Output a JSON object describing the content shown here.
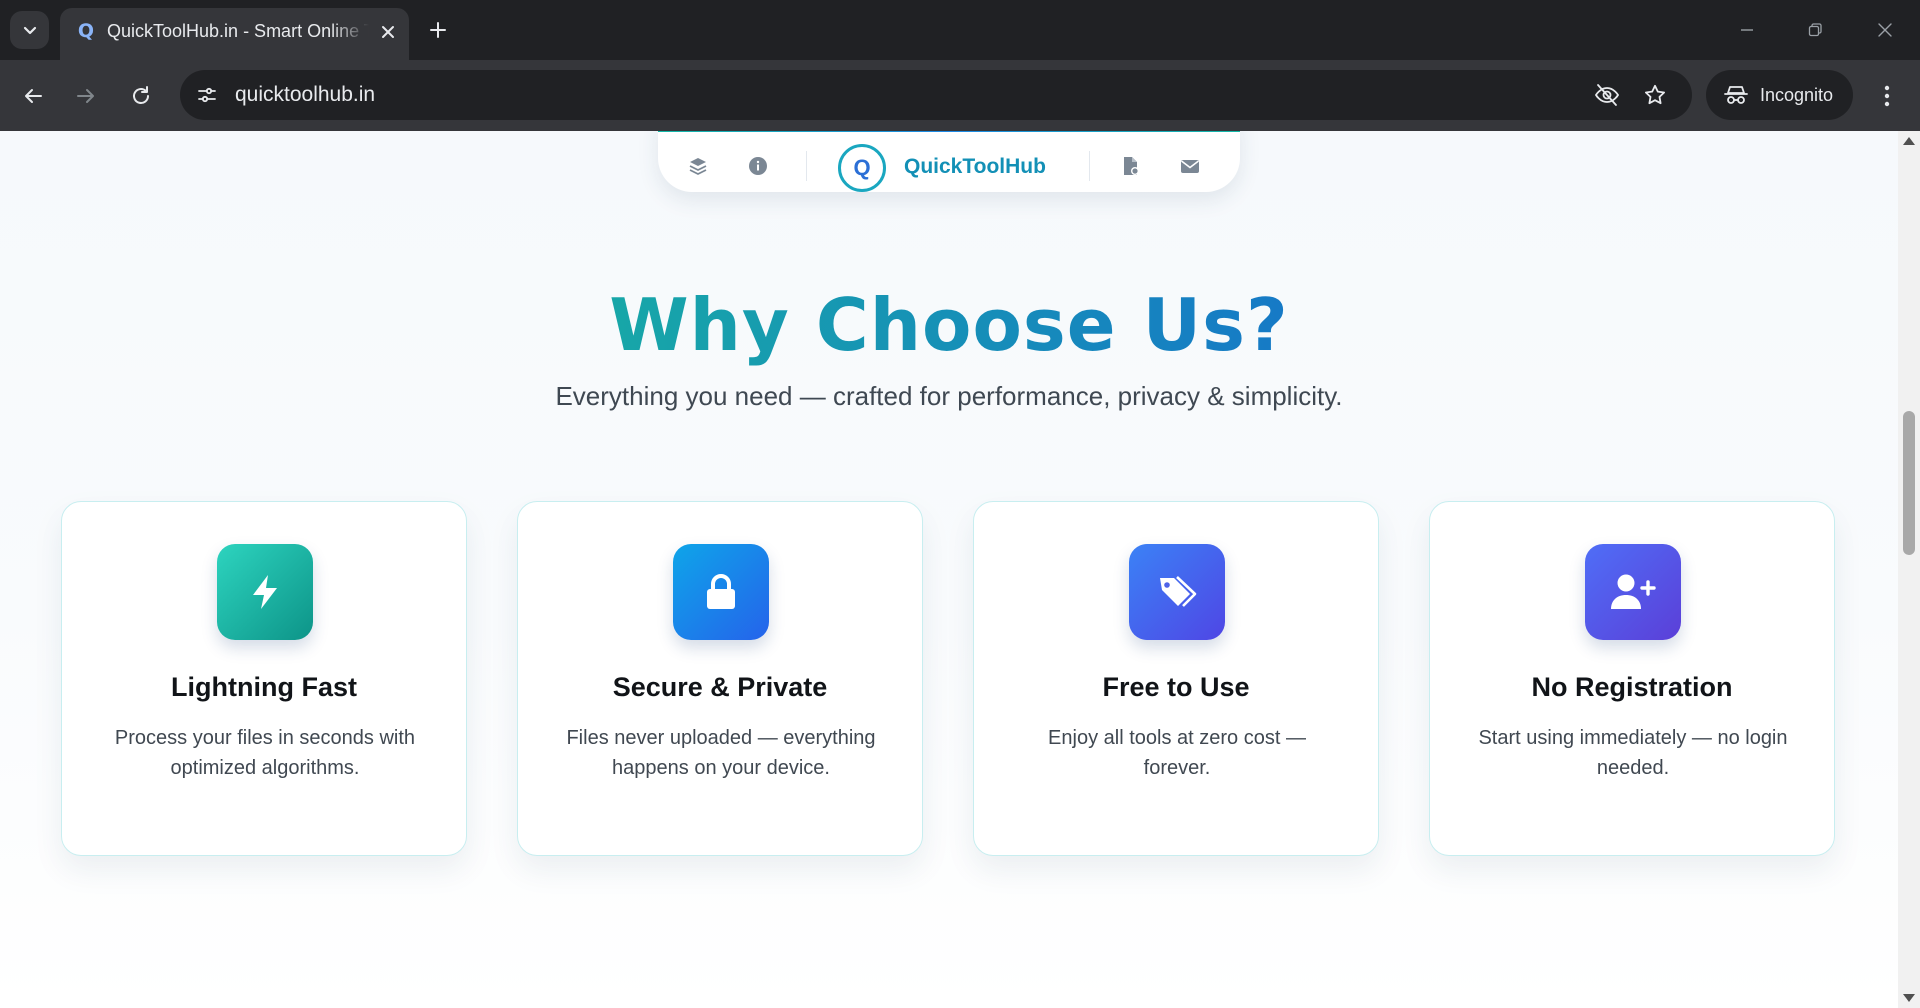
{
  "browser": {
    "tab": {
      "title": "QuickToolHub.in - Smart Online Tools",
      "favicon": "Q"
    },
    "address_bar": {
      "url": "quicktoolhub.in"
    },
    "profile": {
      "label": "Incognito"
    }
  },
  "page": {
    "navbar": {
      "logo_letter": "Q",
      "brand": "QuickToolHub",
      "icons": [
        "layers-icon",
        "info-icon",
        "file-icon",
        "mail-icon"
      ]
    },
    "section": {
      "title": "Why Choose Us?",
      "subtitle": "Everything you need — crafted for performance, privacy & simplicity."
    },
    "features": [
      {
        "title": "Lightning Fast",
        "desc": "Process your files in seconds with optimized algorithms.",
        "icon": "bolt-icon",
        "color_from": "#2dd4bf",
        "color_to": "#0d9488"
      },
      {
        "title": "Secure & Private",
        "desc": "Files never uploaded — everything happens on your device.",
        "icon": "lock-icon",
        "color_from": "#0ea5e9",
        "color_to": "#2563eb"
      },
      {
        "title": "Free to Use",
        "desc": "Enjoy all tools at zero cost — forever.",
        "icon": "tags-icon",
        "color_from": "#3b82f6",
        "color_to": "#4f46e5"
      },
      {
        "title": "No Registration",
        "desc": "Start using immediately — no login needed.",
        "icon": "user-plus-icon",
        "color_from": "#4f6ef7",
        "color_to": "#5b3fd8"
      }
    ]
  }
}
